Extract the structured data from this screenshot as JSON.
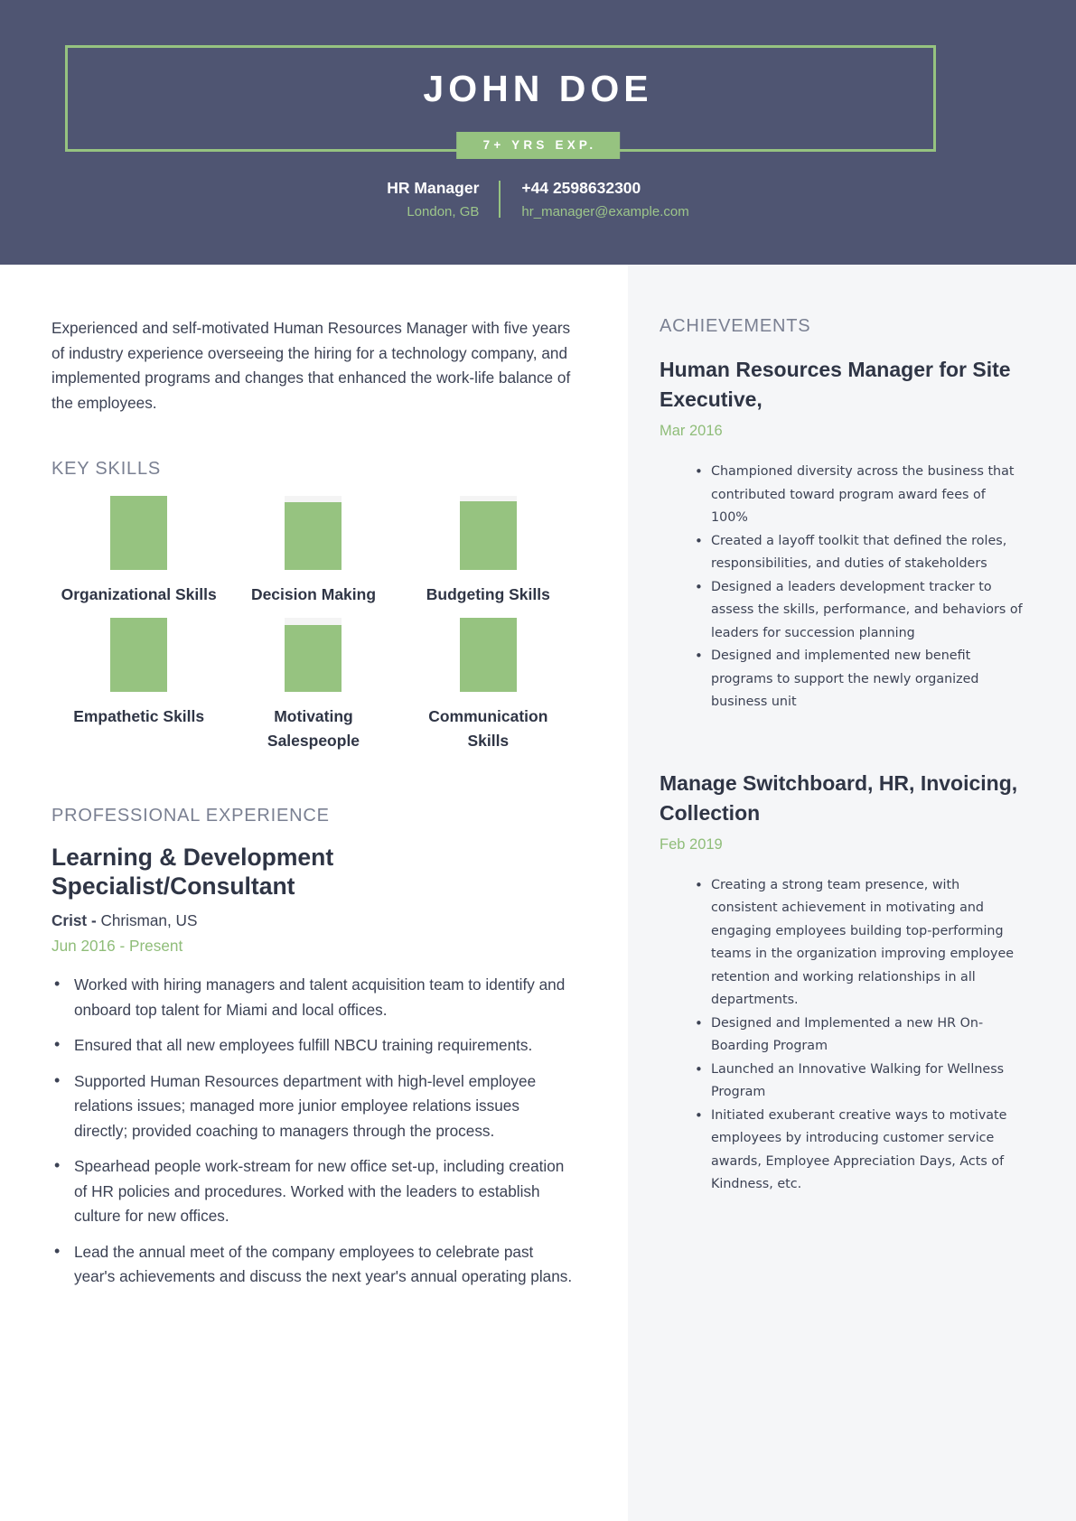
{
  "colors": {
    "header_bg": "#4f5572",
    "accent_green": "#96c380",
    "date_green": "#8fbd79",
    "text_dark": "#3c4254",
    "heading_gray": "#7a8092",
    "right_col_bg": "#f5f6f8"
  },
  "header": {
    "name": "JOHN DOE",
    "experience_badge": "7+ YRS EXP.",
    "job_title": "HR Manager",
    "location": "London, GB",
    "phone": "+44 2598632300",
    "email": "hr_manager@example.com"
  },
  "summary": {
    "text": "Experienced and self-motivated Human Resources Manager with five years of industry experience overseeing the hiring for a technology company, and implemented programs and changes that enhanced the work-life balance of the employees."
  },
  "key_skills": {
    "heading": "KEY SKILLS",
    "items": [
      {
        "label": "Organizational Skills",
        "level": 100
      },
      {
        "label": "Decision Making",
        "level": 92
      },
      {
        "label": "Budgeting Skills",
        "level": 93
      },
      {
        "label": "Empathetic Skills",
        "level": 100
      },
      {
        "label": "Motivating Salespeople",
        "level": 90
      },
      {
        "label": "Communication Skills",
        "level": 100
      }
    ]
  },
  "professional_experience": {
    "heading": "PROFESSIONAL EXPERIENCE",
    "jobs": [
      {
        "title": "Learning & Development Specialist/Consultant",
        "company": "Crist",
        "company_separator": " - ",
        "location": "Chrisman, US",
        "dates": "Jun 2016 - Present",
        "bullets": [
          "Worked with hiring managers and talent acquisition team to identify and onboard top talent for Miami and local offices.",
          "Ensured that all new employees fulfill NBCU training requirements.",
          "Supported Human Resources department with high-level employee relations issues; managed more junior employee relations issues directly; provided coaching to managers through the process.",
          "Spearhead people work-stream for new office set-up, including creation of HR policies and procedures. Worked with the leaders to establish culture for new offices.",
          "Lead the annual meet of the company employees to celebrate past year's achievements and discuss the next year's annual operating plans."
        ]
      }
    ]
  },
  "achievements": {
    "heading": "ACHIEVEMENTS",
    "items": [
      {
        "title": "Human Resources Manager for Site Executive,",
        "date": "Mar 2016",
        "bullets": [
          " Championed diversity across the business that contributed toward program award fees of 100%",
          "Created a layoff toolkit that defined the roles, responsibilities, and duties of stakeholders",
          "Designed a leaders development tracker to assess the skills, performance, and behaviors of leaders for succession planning",
          "Designed and implemented new benefit programs to support the newly organized business unit"
        ]
      },
      {
        "title": "Manage Switchboard, HR, Invoicing, Collection",
        "date": "Feb 2019",
        "bullets": [
          " Creating a strong team presence, with consistent achievement in motivating and engaging employees building top-performing teams in the organization improving employee retention and working relationships in all departments.",
          "Designed and Implemented a new HR On-Boarding Program",
          "Launched an Innovative Walking for Wellness Program",
          "Initiated exuberant creative ways to motivate employees by introducing customer service awards, Employee Appreciation Days, Acts of Kindness, etc."
        ]
      }
    ]
  }
}
